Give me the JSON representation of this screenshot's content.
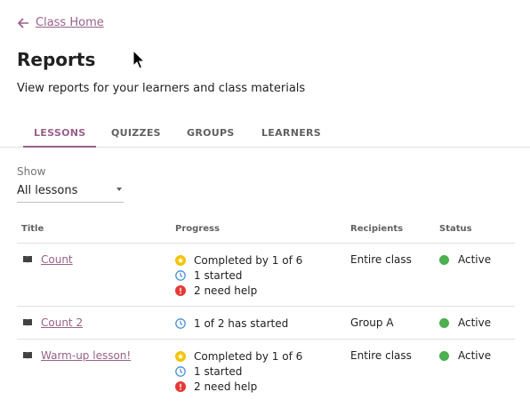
{
  "nav": {
    "back_label": "Class Home"
  },
  "header": {
    "title": "Reports",
    "subtitle": "View reports for your learners and class materials"
  },
  "tabs": [
    {
      "label": "LESSONS",
      "active": true
    },
    {
      "label": "QUIZZES",
      "active": false
    },
    {
      "label": "GROUPS",
      "active": false
    },
    {
      "label": "LEARNERS",
      "active": false
    }
  ],
  "filter": {
    "label": "Show",
    "value": "All lessons"
  },
  "table": {
    "columns": [
      "Title",
      "Progress",
      "Recipients",
      "Status"
    ],
    "rows": [
      {
        "title": "Count",
        "progress": [
          "Completed by 1 of 6",
          "1 started",
          "2 need help"
        ],
        "recipients": "Entire class",
        "status": "Active"
      },
      {
        "title": "Count 2",
        "progress": [
          "1 of 2 has started"
        ],
        "recipients": "Group A",
        "status": "Active"
      },
      {
        "title": "Warm-up lesson!",
        "progress": [
          "Completed by 1 of 6",
          "1 started",
          "2 need help"
        ],
        "recipients": "Entire class",
        "status": "Active"
      }
    ]
  },
  "colors": {
    "accent": "#996189",
    "completed": "#f4c20d",
    "started": "#4a90d9",
    "help": "#e53935",
    "active": "#4caf50"
  },
  "icons": {
    "back": "arrow-left-icon",
    "lesson": "lesson-book-icon",
    "completed": "star-icon",
    "started": "clock-icon",
    "help": "alert-icon",
    "status": "status-dot-icon"
  }
}
